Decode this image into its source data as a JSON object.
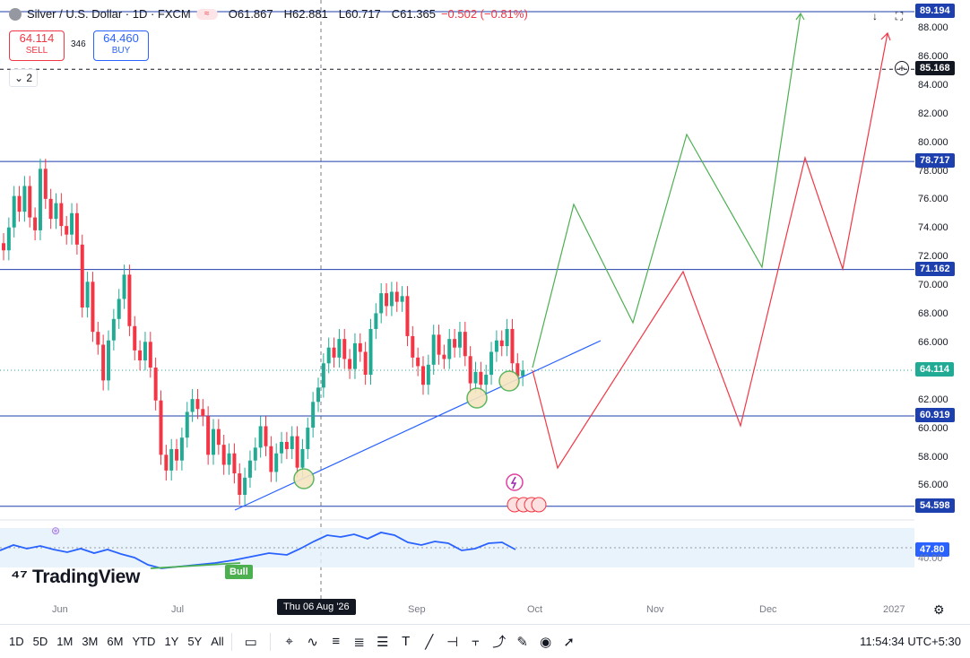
{
  "legend": {
    "title": "Silver / U.S. Dollar · 1D · FXCM",
    "open": "O61.867",
    "high": "H62.881",
    "low": "L60.717",
    "close": "C61.365",
    "change": "−0.502 (−0.81%)"
  },
  "trade": {
    "sell_price": "64.114",
    "sell_label": "SELL",
    "buy_price": "64.460",
    "buy_label": "BUY",
    "spread": "346"
  },
  "collapse_label": "2",
  "price_axis": [
    "88.000",
    "86.000",
    "84.000",
    "82.000",
    "80.000",
    "78.000",
    "76.000",
    "74.000",
    "72.000",
    "70.000",
    "68.000",
    "66.000",
    "64.000",
    "62.000",
    "60.000",
    "58.000",
    "56.000"
  ],
  "levels": [
    {
      "value": "89.194",
      "style": "blue"
    },
    {
      "value": "85.168",
      "style": "dark"
    },
    {
      "value": "78.717",
      "style": "blue"
    },
    {
      "value": "71.162",
      "style": "blue"
    },
    {
      "value": "64.114",
      "style": "green"
    },
    {
      "value": "60.919",
      "style": "blue"
    },
    {
      "value": "54.598",
      "style": "blue"
    }
  ],
  "indicator": {
    "value": "47.80",
    "lower": "40.00",
    "signal": "Bull"
  },
  "time_axis": [
    "Jun",
    "Jul",
    "Sep",
    "Oct",
    "Nov",
    "Dec",
    "2027"
  ],
  "crosshair_date": "Thu 06 Aug '26",
  "brand": "TradingView",
  "toolbar": {
    "timeframes": [
      "1D",
      "5D",
      "1M",
      "3M",
      "6M",
      "YTD",
      "1Y",
      "5Y",
      "All"
    ],
    "clock": "11:54:34 UTC+5:30"
  },
  "colors": {
    "up": "#22ab94",
    "down": "#f23645",
    "level": "#1e3fae",
    "trend": "#2962ff",
    "forecast_up": "#4caf50",
    "forecast_down": "#f23645"
  }
}
